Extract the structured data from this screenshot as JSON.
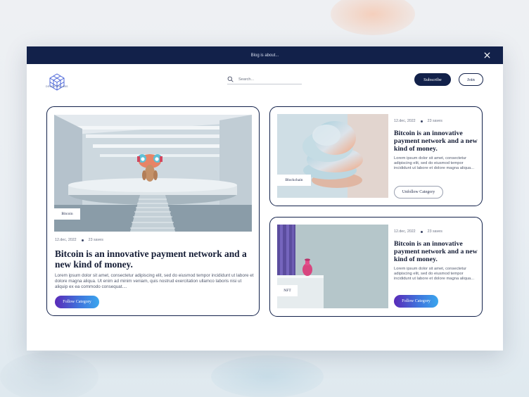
{
  "announcement": {
    "text": "Blog is about..."
  },
  "brand": {
    "name": "DECENTRALABS"
  },
  "search": {
    "placeholder": "Search..."
  },
  "header": {
    "subscribe_label": "Subscribe",
    "join_label": "Join"
  },
  "posts": [
    {
      "tag": "Bitcoin",
      "date": "12.dec, 2022",
      "saves": "23 saves",
      "title": "Bitcoin is an innovative payment network and a new kind of money.",
      "body": "Lorem ipsum dolor sit amet, consectetur adipiscing elit, sed do eiusmod tempor incididunt ut labore et dolore magna aliqua. Ut enim ad minim veniam, quis nostrud exercitation ullamco laboris nisi ut aliquip ex ea commodo consequat....",
      "action_label": "Follow Category"
    },
    {
      "tag": "Blockchain",
      "date": "12.dec, 2022",
      "saves": "23 saves",
      "title": "Bitcoin is an innovative payment network and a new kind of money.",
      "body": "Lorem ipsum dolor sit amet, consectetur adipiscing elit, sed do eiusmod tempor incididunt ut labore et dolore magna aliqua...",
      "action_label": "Unfollow Category"
    },
    {
      "tag": "NFT",
      "date": "12.dec, 2022",
      "saves": "23 saves",
      "title": "Bitcoin is an innovative payment network and a new kind of money.",
      "body": "Lorem ipsum dolor sit amet, consectetur adipiscing elit, sed do eiusmod tempor incididunt ut labore et dolore magna aliqua...",
      "action_label": "Follow Category"
    }
  ],
  "colors": {
    "navy": "#12214a",
    "follow_gradient_start": "#5a2ab8",
    "follow_gradient_end": "#3aa6ee"
  },
  "icons": [
    "close-icon",
    "logo-cube-icon",
    "search-icon"
  ]
}
